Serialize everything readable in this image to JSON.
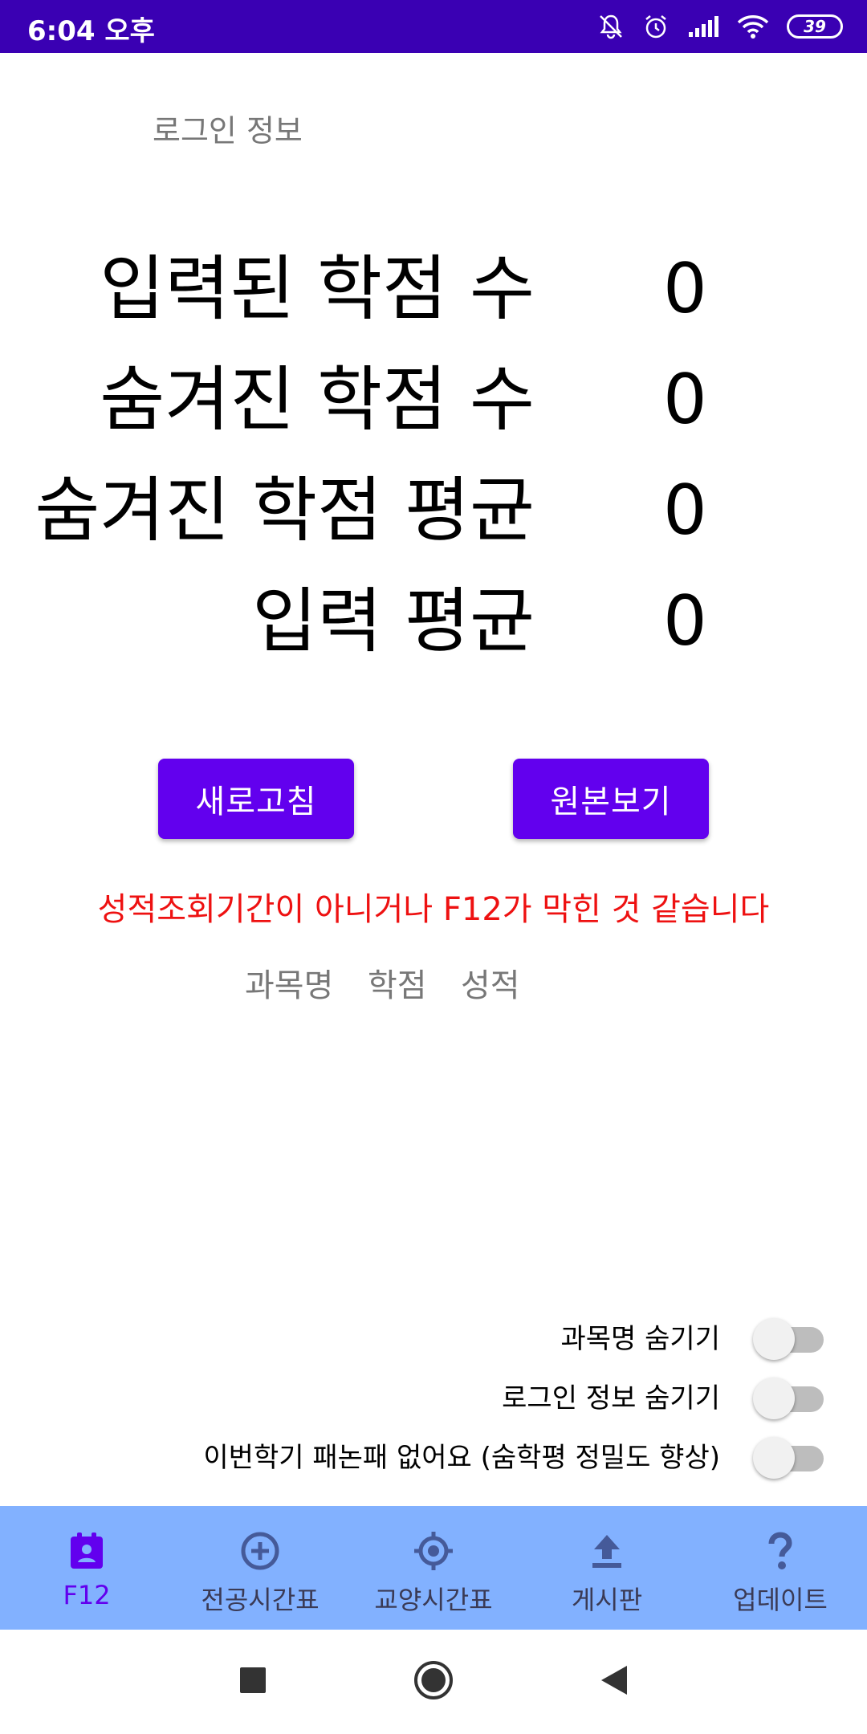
{
  "status_bar": {
    "time": "6:04 오후",
    "battery": "39"
  },
  "login": {
    "label": "로그인 정보"
  },
  "stats": [
    {
      "label": "입력된 학점 수",
      "value": "0"
    },
    {
      "label": "숨겨진 학점 수",
      "value": "0"
    },
    {
      "label": "숨겨진 학점 평균",
      "value": "0"
    },
    {
      "label": "입력 평균",
      "value": "0"
    }
  ],
  "buttons": {
    "refresh": "새로고침",
    "original": "원본보기"
  },
  "error_message": "성적조회기간이 아니거나 F12가 막힌 것 같습니다",
  "table": {
    "headers": [
      "과목명",
      "학점",
      "성적"
    ]
  },
  "toggles": [
    {
      "label": "과목명 숨기기",
      "on": false
    },
    {
      "label": "로그인 정보 숨기기",
      "on": false
    },
    {
      "label": "이번학기 패논패 없어요 (숨학평 정밀도 향상)",
      "on": false
    }
  ],
  "bottom_nav": {
    "items": [
      {
        "label": "F12",
        "icon": "badge-icon"
      },
      {
        "label": "전공시간표",
        "icon": "plus-circle-icon"
      },
      {
        "label": "교양시간표",
        "icon": "crosshair-icon"
      },
      {
        "label": "게시판",
        "icon": "upload-icon"
      },
      {
        "label": "업데이트",
        "icon": "question-icon"
      }
    ],
    "active_index": 0
  },
  "colors": {
    "status_bar": "#3a00b3",
    "accent": "#6200ee",
    "nav_background": "#82b1ff",
    "error": "#ee1111"
  }
}
